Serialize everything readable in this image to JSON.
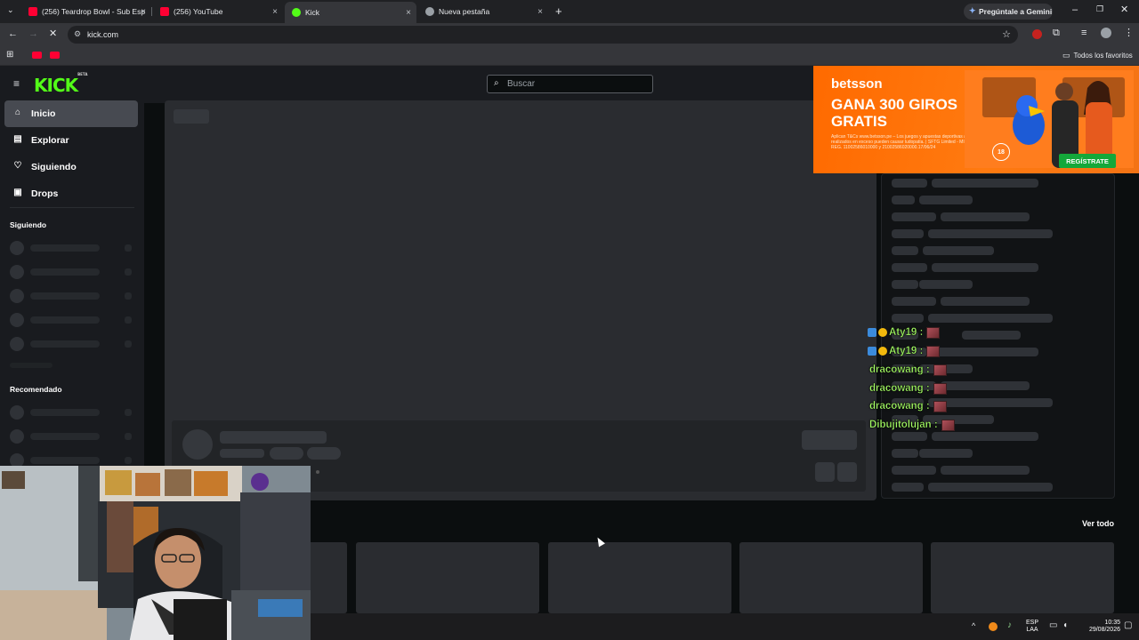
{
  "browser": {
    "tabs": [
      {
        "title": "(256) Teardrop Bowl - Sub Esp",
        "favicon_color": "#ff0033"
      },
      {
        "title": "(256) YouTube",
        "favicon_color": "#ff0033"
      },
      {
        "title": "Kick",
        "favicon_color": "#53fc18"
      },
      {
        "title": "Nueva pestaña",
        "favicon_color": "#9aa0a6"
      }
    ],
    "gemini_label": "Pregúntale a Gemini",
    "url": "kick.com",
    "bookmarks_folder": "Todos los favoritos"
  },
  "kick": {
    "logo": "KICK",
    "logo_tag": "BETA",
    "search_placeholder": "Buscar",
    "nav": [
      {
        "label": "Inicio",
        "icon": "home-icon",
        "active": true
      },
      {
        "label": "Explorar",
        "icon": "compass-icon",
        "active": false
      },
      {
        "label": "Siguiendo",
        "icon": "heart-icon",
        "active": false
      },
      {
        "label": "Drops",
        "icon": "gift-icon",
        "active": false
      }
    ],
    "section_following": "Siguiendo",
    "section_recommended": "Recomendado",
    "view_all": "Ver todo",
    "brand_color": "#53fc18"
  },
  "ad": {
    "brand": "betsson",
    "headline": "GANA 300 GIROS GRATIS",
    "fine_print": "Aplican T&Cs www.betsson.pe – Los juegos y apuestas deportivas a distancia realizados en exceso pueden causar ludopatía. | SFTG Limited - MINCETUR REG. 11002586010000 y 21002586020000.17/06/24",
    "age": "18",
    "cta": "REGÍSTRATE"
  },
  "overlay_chat": [
    {
      "user": "Aty19 :",
      "badges": true
    },
    {
      "user": "Aty19 :",
      "badges": true
    },
    {
      "user": "dracowang :",
      "badges": false
    },
    {
      "user": "dracowang :",
      "badges": false
    },
    {
      "user": "dracowang :",
      "badges": false
    },
    {
      "user": "Dibujitolujan :",
      "badges": false
    }
  ],
  "taskbar": {
    "lang": "ESP",
    "layout": "LAA",
    "time": "10:35",
    "date": "29/08/2026"
  }
}
